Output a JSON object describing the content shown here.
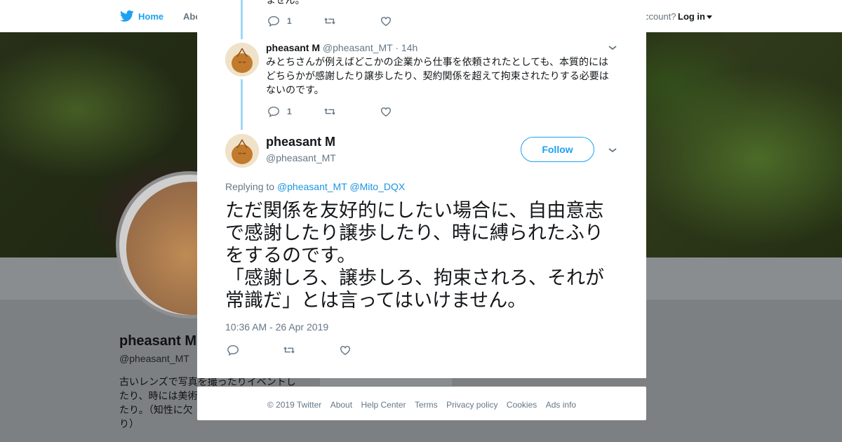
{
  "nav": {
    "home": "Home",
    "about": "Abo",
    "account_prompt": "ccount?",
    "login": "Log in"
  },
  "profile": {
    "name": "pheasant M",
    "handle": "@pheasant_MT",
    "bio_lines": [
      "古いレンズで写真を撮ったりイベントし",
      "たり、時には美術",
      "たり。（知性に欠",
      "り）"
    ]
  },
  "thread": {
    "prev_tweet_tail": "ません。",
    "prev_reply_count": "1",
    "reply": {
      "name": "pheasant M",
      "handle": "@pheasant_MT",
      "time": "· 14h",
      "lines": [
        "みとちさんが例えばどこかの企業から仕事を依頼されたとしても、本質的には",
        "どちらかが感謝したり譲歩したり、契約関係を超えて拘束されたりする必要は",
        "ないのです。"
      ],
      "reply_count": "1"
    }
  },
  "main_tweet": {
    "name": "pheasant M",
    "handle": "@pheasant_MT",
    "follow_label": "Follow",
    "replying_prefix": "Replying to",
    "replying_to": [
      "@pheasant_MT",
      "@Mito_DQX"
    ],
    "lines": [
      "ただ関係を友好的にしたい場合に、自由意志",
      "で感謝したり譲歩したり、時に縛られたふり",
      "をするのです。",
      "「感謝しろ、譲歩しろ、拘束されろ、それが",
      "常識だ」とは言ってはいけません。"
    ],
    "timestamp": "10:36 AM - 26 Apr 2019"
  },
  "footer": {
    "links": [
      "© 2019 Twitter",
      "About",
      "Help Center",
      "Terms",
      "Privacy policy",
      "Cookies",
      "Ads info"
    ]
  },
  "close_label": "×",
  "colors": {
    "accent": "#1da1f2",
    "thread_line": "#9fd8f8",
    "text": "#14171a",
    "muted": "#657786"
  }
}
